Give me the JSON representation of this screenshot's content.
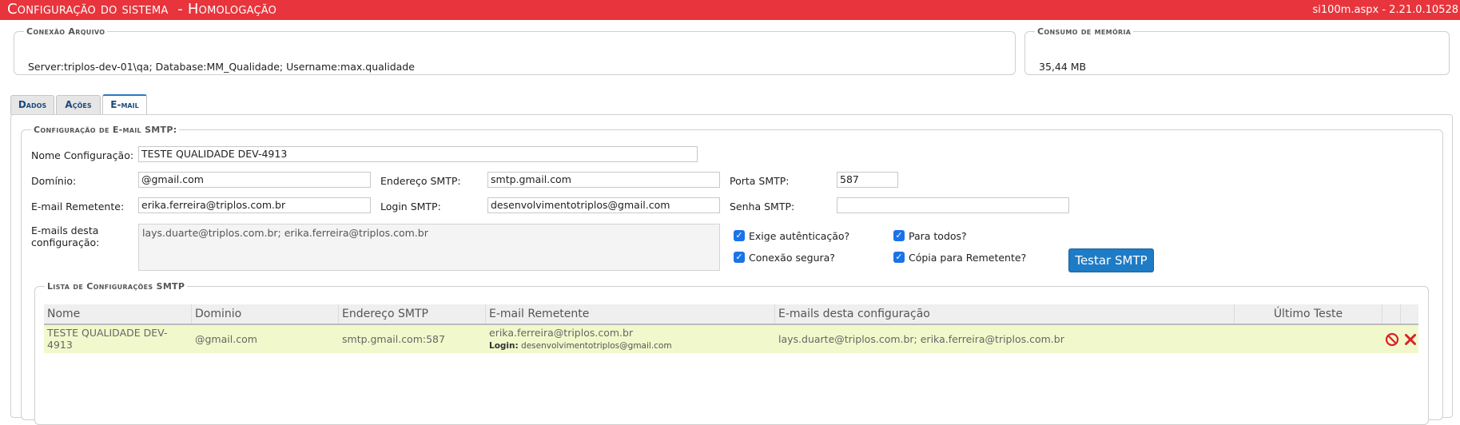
{
  "header": {
    "title": "Configuração do sistema  - Homologação",
    "version": "si100m.aspx - 2.21.0.10528"
  },
  "connection": {
    "legend": "Conexão Arquivo",
    "value": "Server:triplos-dev-01\\qa; Database:MM_Qualidade; Username:max.qualidade"
  },
  "memory": {
    "legend": "Consumo de memória",
    "value": "35,44 MB"
  },
  "tabs": [
    {
      "label": "Dados"
    },
    {
      "label": "Ações"
    },
    {
      "label": "E-mail"
    }
  ],
  "smtp_config": {
    "legend": "Configuração de E-mail SMTP:",
    "name_label": "Nome Configuração:",
    "name_value": "TESTE QUALIDADE DEV-4913",
    "domain_label": "Domínio:",
    "domain_value": "@gmail.com",
    "address_label": "Endereço SMTP:",
    "address_value": "smtp.gmail.com",
    "port_label": "Porta SMTP:",
    "port_value": "587",
    "sender_label": "E-mail Remetente:",
    "sender_value": "erika.ferreira@triplos.com.br",
    "login_label": "Login SMTP:",
    "login_value": "desenvolvimentotriplos@gmail.com",
    "password_label": "Senha SMTP:",
    "password_value": "",
    "emails_label": "E-mails desta configuração:",
    "emails_value": "lays.duarte@triplos.com.br; erika.ferreira@triplos.com.br",
    "checkboxes": [
      {
        "label": "Exige autênticação?",
        "checked": true
      },
      {
        "label": "Para todos?",
        "checked": true
      },
      {
        "label": "Conexão segura?",
        "checked": true
      },
      {
        "label": "Cópia para Remetente?",
        "checked": true
      }
    ],
    "test_button": "Testar SMTP"
  },
  "smtp_list": {
    "legend": "Lista de Configurações SMTP",
    "columns": [
      "Nome",
      "Dominio",
      "Endereço SMTP",
      "E-mail Remetente",
      "E-mails desta configuração",
      "Último Teste"
    ],
    "rows": [
      {
        "name": "TESTE QUALIDADE DEV-4913",
        "domain": "@gmail.com",
        "smtp": "smtp.gmail.com:587",
        "sender": "erika.ferreira@triplos.com.br",
        "login_label": "Login:",
        "login": "desenvolvimentotriplos@gmail.com",
        "emails": "lays.duarte@triplos.com.br; erika.ferreira@triplos.com.br",
        "last_test": ""
      }
    ]
  },
  "colors": {
    "title_bar": "#e8343c",
    "button": "#1e7bc6",
    "row_highlight": "#f1f9cc",
    "checkbox": "#1a73e8",
    "icon_red": "#d9222a"
  }
}
